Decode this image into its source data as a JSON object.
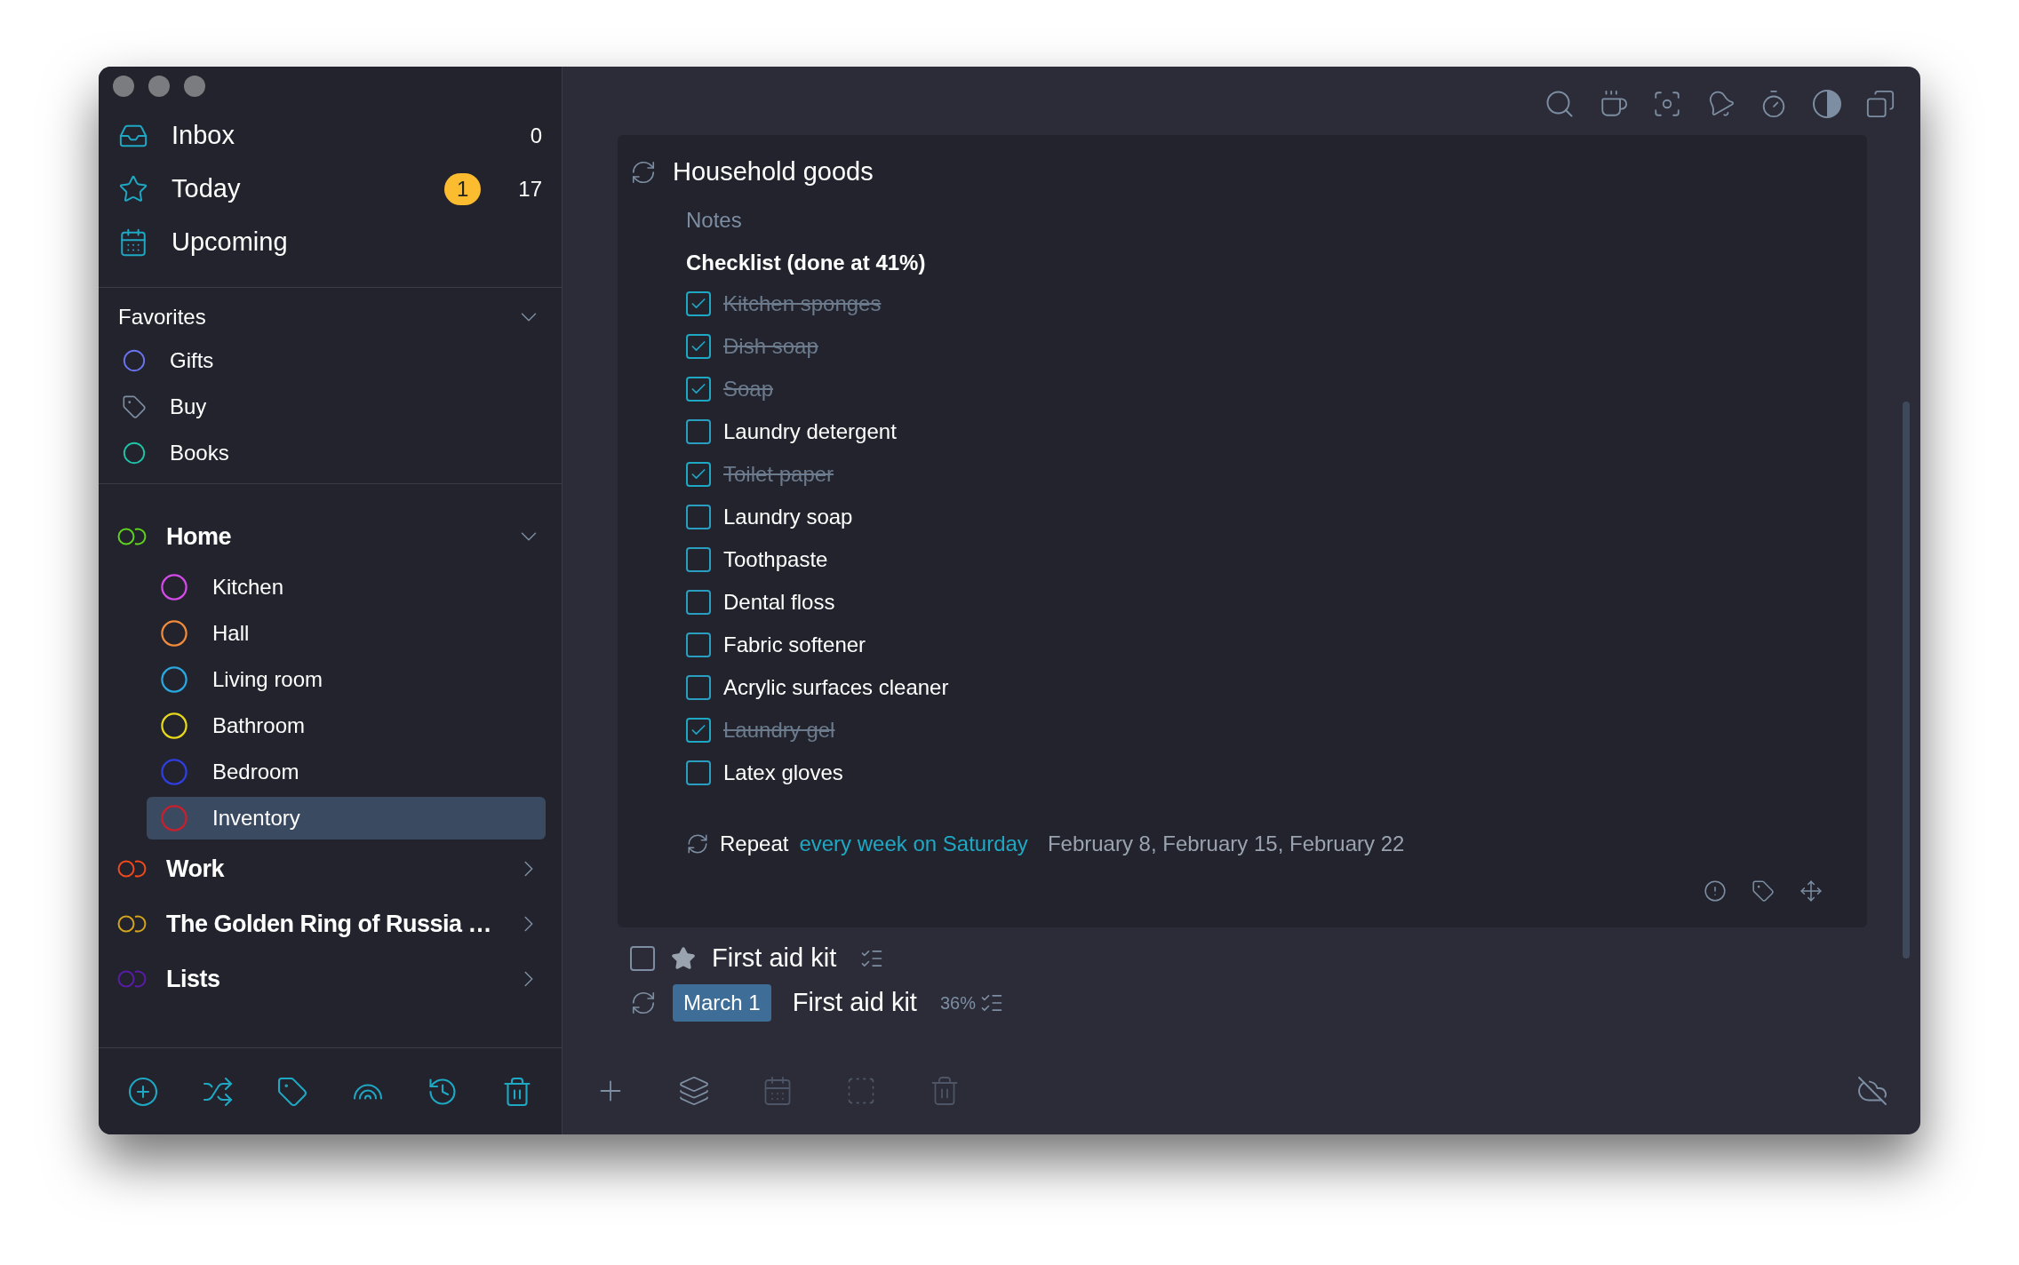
{
  "sidebar": {
    "main_items": [
      {
        "kind": "inbox",
        "label": "Inbox",
        "count": "0"
      },
      {
        "kind": "today",
        "label": "Today",
        "badge": "1",
        "count": "17"
      },
      {
        "kind": "upcoming",
        "label": "Upcoming"
      }
    ],
    "favorites": {
      "title": "Favorites",
      "expanded": true,
      "items": [
        {
          "kind": "progress",
          "label": "Gifts",
          "color": "#6b74f0"
        },
        {
          "kind": "tag",
          "label": "Buy"
        },
        {
          "kind": "progress",
          "label": "Books",
          "color": "#1fc4a8"
        }
      ]
    },
    "projects": [
      {
        "label": "Home",
        "color": "#5fd21e",
        "expanded": true,
        "children": [
          {
            "label": "Kitchen",
            "color": "#d44ae8",
            "selected": false
          },
          {
            "label": "Hall",
            "color": "#f08a3c",
            "selected": false
          },
          {
            "label": "Living room",
            "color": "#2aa6e0",
            "selected": false
          },
          {
            "label": "Bathroom",
            "color": "#e8d81c",
            "selected": false
          },
          {
            "label": "Bedroom",
            "color": "#2f3ee0",
            "selected": false
          },
          {
            "label": "Inventory",
            "color": "#c8202e",
            "selected": true
          }
        ]
      },
      {
        "label": "Work",
        "color": "#f04a1c",
        "expanded": false
      },
      {
        "label": "The Golden Ring of Russia …",
        "color": "#d4a41c",
        "expanded": false
      },
      {
        "label": "Lists",
        "color": "#5a1ca8",
        "expanded": false
      }
    ]
  },
  "task": {
    "title": "Household goods",
    "notes_placeholder": "Notes",
    "checklist_title": "Checklist (done at 41%)",
    "checklist": [
      {
        "label": "Kitchen sponges",
        "checked": true
      },
      {
        "label": "Dish soap",
        "checked": true
      },
      {
        "label": "Soap",
        "checked": true
      },
      {
        "label": "Laundry detergent",
        "checked": false
      },
      {
        "label": "Toilet paper",
        "checked": true
      },
      {
        "label": "Laundry soap",
        "checked": false
      },
      {
        "label": "Toothpaste",
        "checked": false
      },
      {
        "label": "Dental floss",
        "checked": false
      },
      {
        "label": "Fabric softener",
        "checked": false
      },
      {
        "label": "Acrylic surfaces cleaner",
        "checked": false
      },
      {
        "label": "Laundry gel",
        "checked": true
      },
      {
        "label": "Latex gloves",
        "checked": false
      }
    ],
    "repeat": {
      "label": "Repeat",
      "rule": "every week on Saturday",
      "dates": "February 8, February 15, February 22"
    }
  },
  "tasks": [
    {
      "kind": "starred",
      "title": "First aid kit",
      "checked": false
    },
    {
      "kind": "recurring",
      "date": "March 1",
      "title": "First aid kit",
      "progress": "36%"
    }
  ],
  "bottom_toolbar": [
    {
      "kind": "add",
      "disabled": false
    },
    {
      "kind": "layers",
      "disabled": false
    },
    {
      "kind": "calendar",
      "disabled": true
    },
    {
      "kind": "move",
      "disabled": true
    },
    {
      "kind": "trash",
      "disabled": true
    }
  ]
}
